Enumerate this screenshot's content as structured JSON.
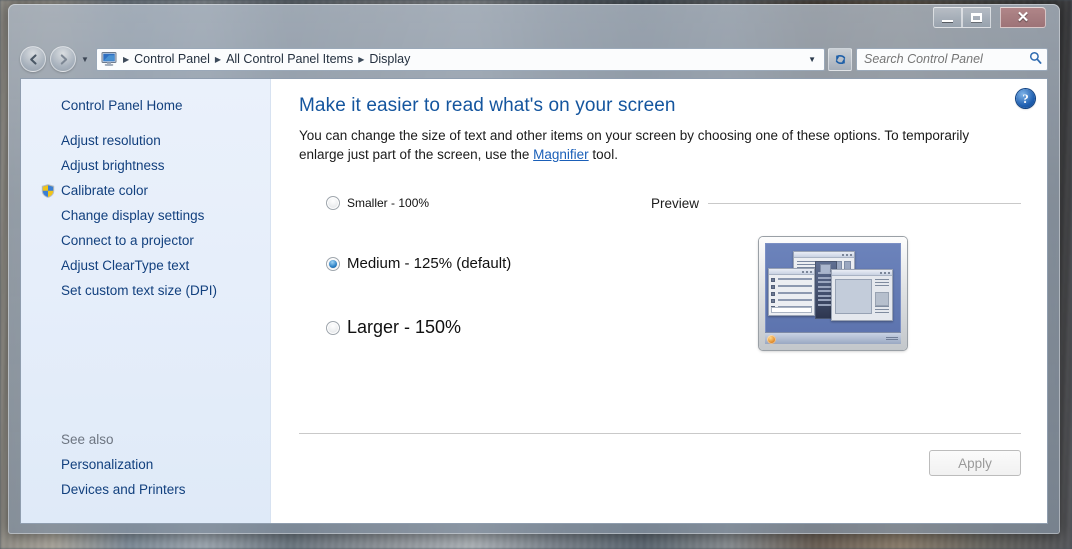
{
  "window": {
    "title_controls": {
      "minimize": "—",
      "maximize": "❐",
      "close": "✕"
    }
  },
  "addressbar": {
    "back_glyph": "←",
    "forward_glyph": "→",
    "history_glyph": "▼",
    "icon_name": "display-monitor-icon",
    "breadcrumbs": [
      "Control Panel",
      "All Control Panel Items",
      "Display"
    ],
    "separator": "▶",
    "dropdown_glyph": "▼",
    "refresh_glyph": "↻",
    "search": {
      "placeholder": "Search Control Panel",
      "value": "",
      "icon_glyph": "⚲"
    }
  },
  "sidebar": {
    "home_label": "Control Panel Home",
    "items": [
      {
        "label": "Adjust resolution",
        "shield": false
      },
      {
        "label": "Adjust brightness",
        "shield": false
      },
      {
        "label": "Calibrate color",
        "shield": true
      },
      {
        "label": "Change display settings",
        "shield": false
      },
      {
        "label": "Connect to a projector",
        "shield": false
      },
      {
        "label": "Adjust ClearType text",
        "shield": false
      },
      {
        "label": "Set custom text size (DPI)",
        "shield": false
      }
    ],
    "see_also_label": "See also",
    "see_also_items": [
      {
        "label": "Personalization"
      },
      {
        "label": "Devices and Printers"
      }
    ]
  },
  "main": {
    "help_glyph": "?",
    "title": "Make it easier to read what's on your screen",
    "desc_part1": "You can change the size of text and other items on your screen by choosing one of these options. To temporarily enlarge just part of the screen, use the ",
    "desc_link": "Magnifier",
    "desc_part2": " tool.",
    "options": [
      {
        "label": "Smaller - 100%",
        "checked": false
      },
      {
        "label": "Medium - 125% (default)",
        "checked": true
      },
      {
        "label": "Larger - 150%",
        "checked": false
      }
    ],
    "preview_label": "Preview",
    "apply_label": "Apply",
    "apply_enabled": false,
    "colors": {
      "title": "#14559e",
      "link": "#1a5fb8",
      "sidebar_link": "#12407e"
    }
  }
}
